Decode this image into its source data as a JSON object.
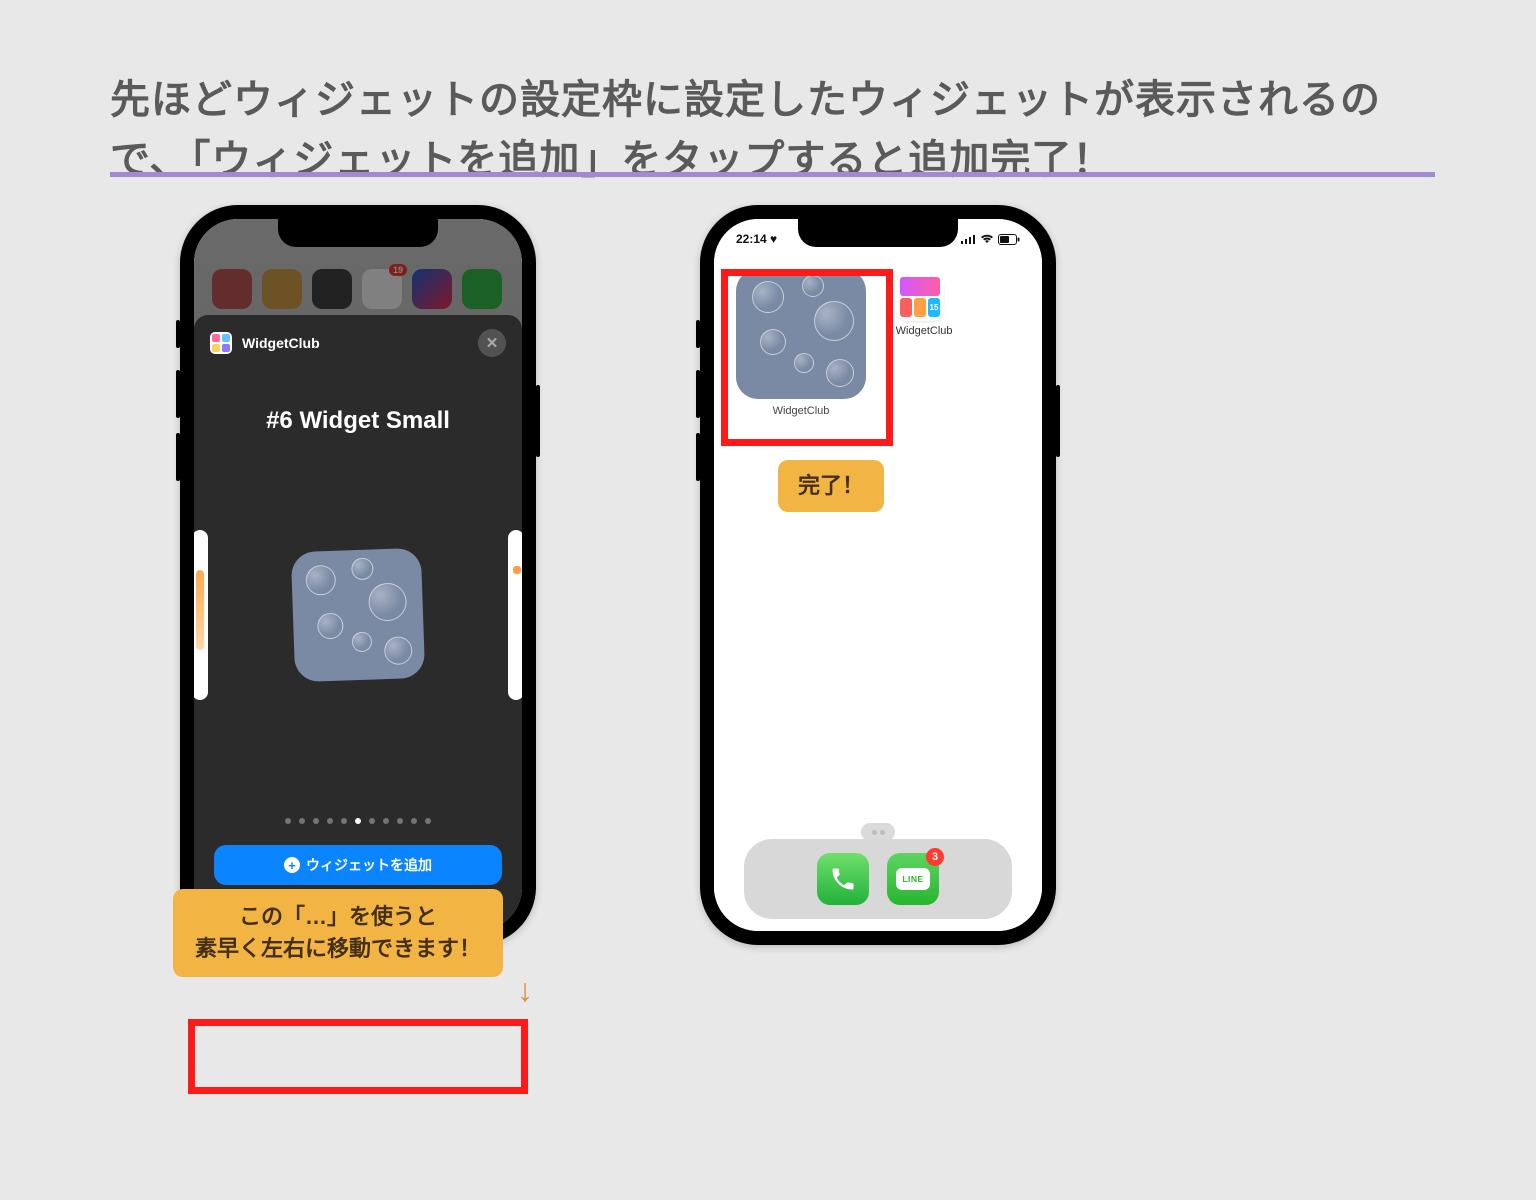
{
  "heading": "先ほどウィジェットの設定枠に設定したウィジェットが表示されるので、「ウィジェットを追加」をタップすると追加完了！",
  "left": {
    "blur_badge": "19",
    "sheet_app": "WidgetClub",
    "title": "#6 Widget Small",
    "dots_total": 11,
    "dots_active_index": 5,
    "add_button": "ウィジェットを追加"
  },
  "right": {
    "time": "22:14",
    "widget_label": "WidgetClub",
    "app_label": "WidgetClub",
    "line_text": "LINE",
    "line_badge": "3"
  },
  "callouts": {
    "tip_line1": "この「…」を使うと",
    "tip_line2": "素早く左右に移動できます！",
    "done": "完了！"
  }
}
